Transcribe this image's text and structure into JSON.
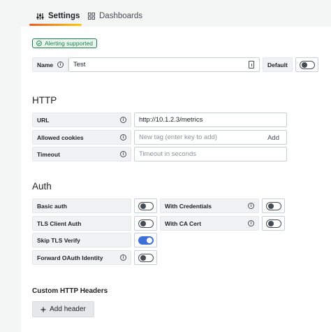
{
  "tabs": [
    {
      "label": "Settings",
      "icon": "sliders-icon",
      "active": true
    },
    {
      "label": "Dashboards",
      "icon": "grid-icon",
      "active": false
    }
  ],
  "badge": "Alerting supported",
  "name_row": {
    "label": "Name",
    "value": "Test",
    "default_label": "Default",
    "default_on": false
  },
  "http": {
    "title": "HTTP",
    "url": {
      "label": "URL",
      "value": "http://10.1.2.3/metrics"
    },
    "cookies": {
      "label": "Allowed cookies",
      "placeholder": "New tag (enter key to add)",
      "add_label": "Add"
    },
    "timeout": {
      "label": "Timeout",
      "placeholder": "Timeout in seconds"
    }
  },
  "auth": {
    "title": "Auth",
    "basic": {
      "label": "Basic auth",
      "on": false
    },
    "with_credentials": {
      "label": "With Credentials",
      "on": false
    },
    "tls_client": {
      "label": "TLS Client Auth",
      "on": false
    },
    "with_ca": {
      "label": "With CA Cert",
      "on": false
    },
    "skip_tls": {
      "label": "Skip TLS Verify",
      "on": true
    },
    "forward_oauth": {
      "label": "Forward OAuth Identity",
      "on": false
    }
  },
  "custom_headers": {
    "title": "Custom HTTP Headers",
    "add_label": "Add header"
  },
  "colors": {
    "accent": "#3d71d9",
    "success": "#1a7f4b",
    "tab_gradient_start": "#f05a28",
    "tab_gradient_end": "#fbca0a"
  }
}
